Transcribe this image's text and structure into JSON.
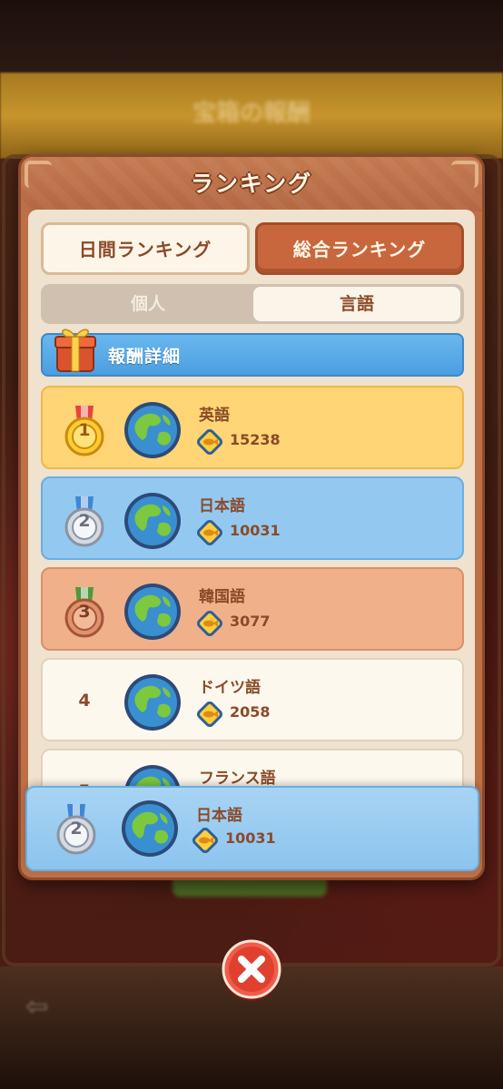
{
  "background": {
    "banner_title": "宝箱の報酬"
  },
  "modal": {
    "title": "ランキング"
  },
  "tabs": {
    "daily_label": "日間ランキング",
    "overall_label": "総合ランキング"
  },
  "segmented": {
    "individual_label": "個人",
    "language_label": "言語"
  },
  "reward": {
    "label": "報酬詳細"
  },
  "rankings": [
    {
      "rank": "1",
      "label": "英語",
      "score": "15238",
      "medal": "gold"
    },
    {
      "rank": "2",
      "label": "日本語",
      "score": "10031",
      "medal": "silver"
    },
    {
      "rank": "3",
      "label": "韓国語",
      "score": "3077",
      "medal": "bronze"
    },
    {
      "rank": "4",
      "label": "ドイツ語",
      "score": "2058",
      "medal": "none"
    },
    {
      "rank": "5",
      "label": "フランス語",
      "score": "",
      "medal": "none"
    }
  ],
  "my_ranking": {
    "rank": "2",
    "label": "日本語",
    "score": "10031",
    "medal": "silver"
  },
  "colors": {
    "row_gold": "#ffd575",
    "row_silver": "#93c9f0",
    "row_bronze": "#f0b089",
    "row_plain": "#fdf8ee",
    "text_brown": "#8a4a2a"
  },
  "icons": {
    "gift": "gift-box-icon",
    "globe": "globe-icon",
    "coin": "fish-coin-icon",
    "close": "close-icon",
    "back": "back-arrow-icon"
  }
}
